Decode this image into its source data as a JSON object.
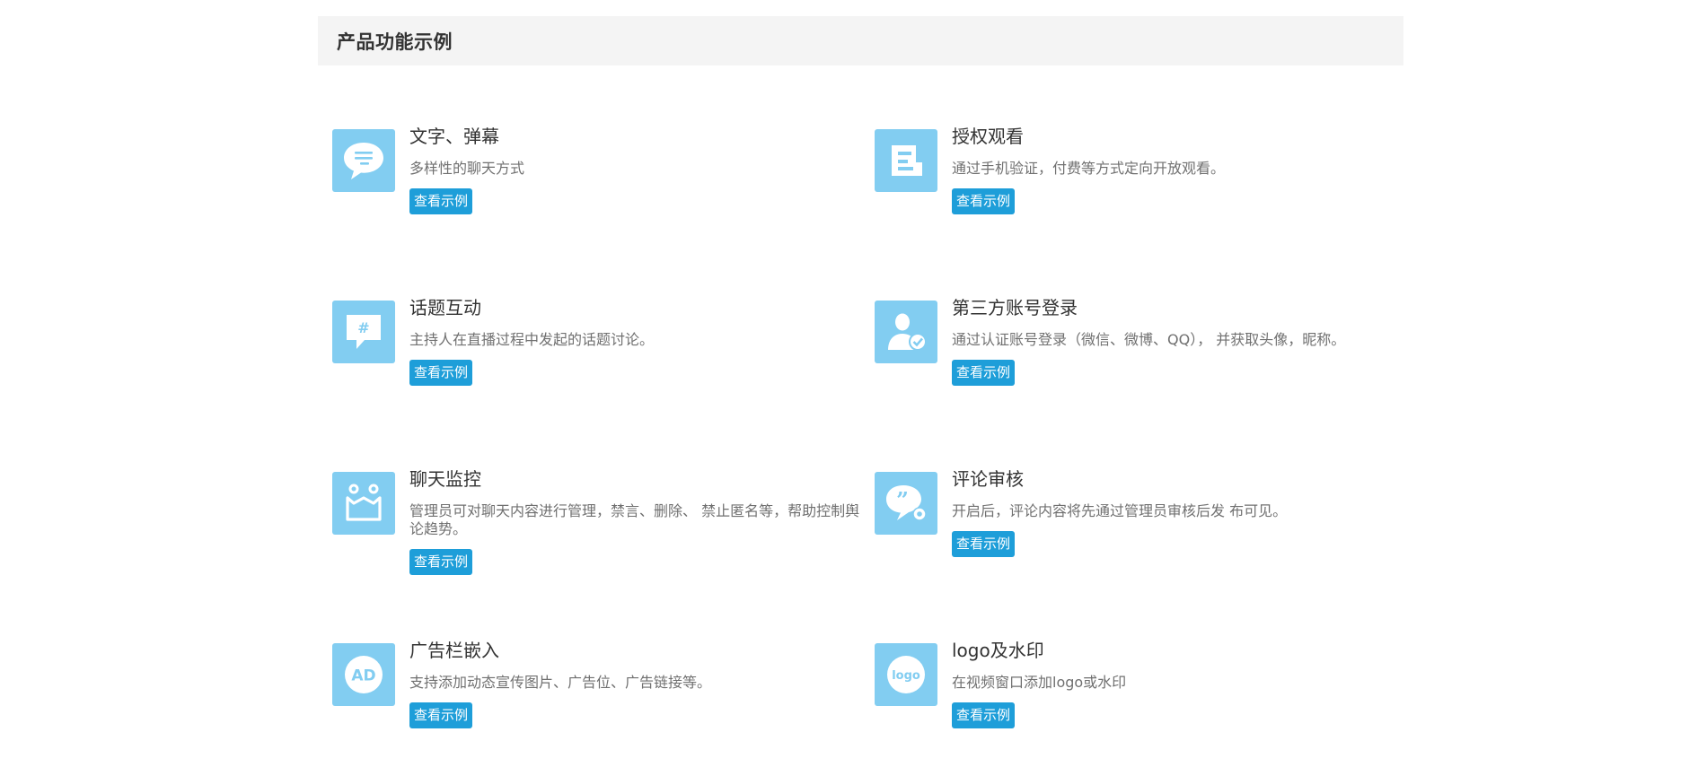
{
  "section": {
    "title": "产品功能示例"
  },
  "accent_color": "#1e9ed9",
  "icon_bg_color": "#82cdf1",
  "features": [
    {
      "icon": "chat-bubble-icon",
      "title": "文字、弹幕",
      "desc": "多样性的聊天方式",
      "button": "查看示例"
    },
    {
      "icon": "document-icon",
      "title": "授权观看",
      "desc": "通过手机验证，付费等方式定向开放观看。",
      "button": "查看示例"
    },
    {
      "icon": "hashtag-bubble-icon",
      "title": "话题互动",
      "desc": "主持人在直播过程中发起的话题讨论。",
      "button": "查看示例"
    },
    {
      "icon": "user-verified-icon",
      "title": "第三方账号登录",
      "desc": "通过认证账号登录（微信、微博、QQ）， 并获取头像，昵称。",
      "button": "查看示例"
    },
    {
      "icon": "monitor-people-icon",
      "title": "聊天监控",
      "desc": "管理员可对聊天内容进行管理，禁言、删除、 禁止匿名等，帮助控制舆论趋势。",
      "button": "查看示例"
    },
    {
      "icon": "quote-gear-icon",
      "title": "评论审核",
      "desc": "开启后，评论内容将先通过管理员审核后发 布可见。",
      "button": "查看示例"
    },
    {
      "icon": "ad-icon",
      "title": "广告栏嵌入",
      "desc": "支持添加动态宣传图片、广告位、广告链接等。",
      "button": "查看示例"
    },
    {
      "icon": "logo-icon",
      "title": "logo及水印",
      "desc": "在视频窗口添加logo或水印",
      "button": "查看示例"
    }
  ]
}
